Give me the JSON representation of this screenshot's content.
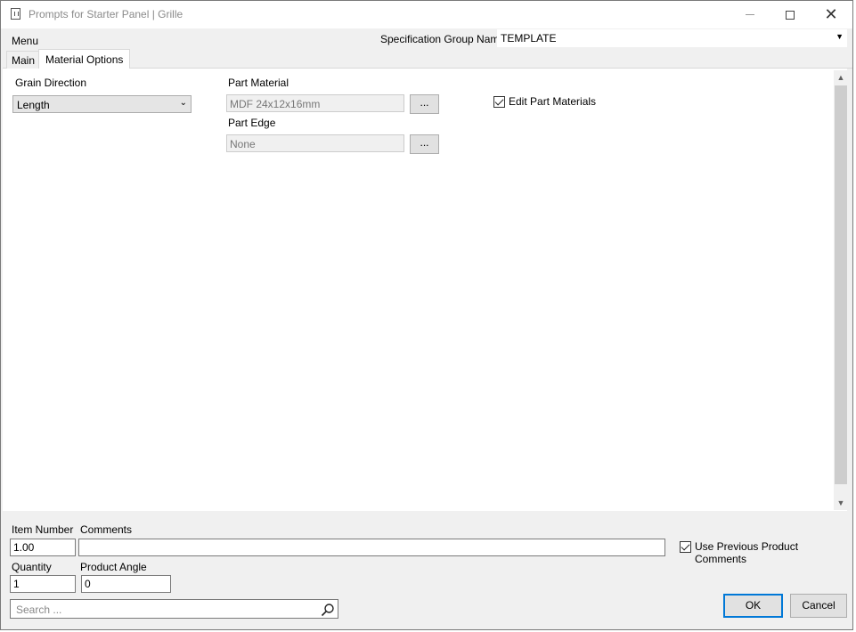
{
  "window": {
    "title": "Prompts for Starter Panel | Grille",
    "controls": [
      "minimize-icon",
      "maximize-icon",
      "close-icon"
    ],
    "close_glyph": "✕"
  },
  "menu": {
    "label": "Menu"
  },
  "specification": {
    "label": "Specification Group Name",
    "value": "TEMPLATE"
  },
  "tabs": [
    {
      "label": "Main",
      "selected": false
    },
    {
      "label": "Material Options",
      "selected": true
    }
  ],
  "material_options": {
    "grain_direction": {
      "label": "Grain Direction",
      "value": "Length"
    },
    "part_material": {
      "label": "Part Material",
      "value": "MDF 24x12x16mm",
      "button": "..."
    },
    "part_edge": {
      "label": "Part Edge",
      "value": "None",
      "button": "..."
    },
    "edit_part_materials": {
      "label": "Edit Part Materials",
      "checked": true
    }
  },
  "footer": {
    "item_number": {
      "label": "Item Number",
      "value": "1.00"
    },
    "comments": {
      "label": "Comments",
      "value": ""
    },
    "use_previous_comments": {
      "label": "Use Previous Product Comments",
      "checked": true
    },
    "quantity": {
      "label": "Quantity",
      "value": "1"
    },
    "product_angle": {
      "label": "Product Angle",
      "value": "0"
    },
    "search": {
      "placeholder": "Search ..."
    },
    "ok_label": "OK",
    "cancel_label": "Cancel"
  },
  "colors": {
    "accent": "#0078d7",
    "window_bg": "#f0f0f0",
    "panel_bg": "#ffffff"
  }
}
